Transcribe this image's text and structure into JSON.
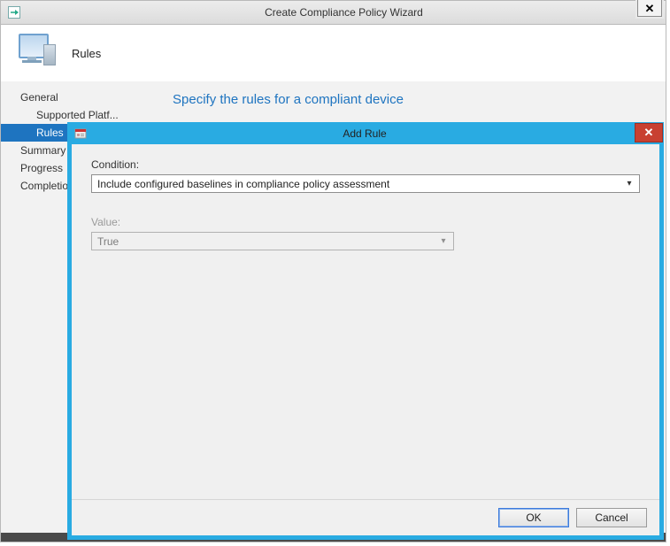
{
  "wizard": {
    "title": "Create Compliance Policy Wizard",
    "close_glyph": "✕",
    "banner_title": "Rules",
    "nav": {
      "items": [
        {
          "label": "General",
          "sub": false,
          "selected": false
        },
        {
          "label": "Supported Platf...",
          "sub": true,
          "selected": false
        },
        {
          "label": "Rules",
          "sub": true,
          "selected": true
        },
        {
          "label": "Summary",
          "sub": false,
          "selected": false
        },
        {
          "label": "Progress",
          "sub": false,
          "selected": false
        },
        {
          "label": "Completion",
          "sub": false,
          "selected": false
        }
      ]
    },
    "instruction": "Specify the rules for a compliant device"
  },
  "addrule": {
    "title": "Add Rule",
    "close_glyph": "✕",
    "condition": {
      "label": "Condition:",
      "value": "Include configured baselines in compliance policy assessment"
    },
    "value": {
      "label": "Value:",
      "value": "True",
      "disabled": true
    },
    "buttons": {
      "ok": "OK",
      "cancel": "Cancel"
    }
  },
  "icons": {
    "wizard_left": "wizard-app-icon",
    "computer": "computer-icon",
    "form_app": "form-app-icon",
    "dropdown": "chevron-down-icon"
  }
}
